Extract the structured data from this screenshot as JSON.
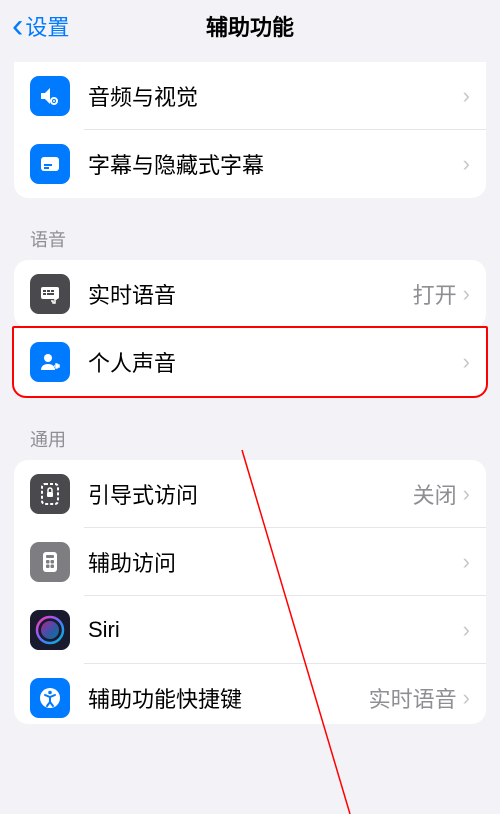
{
  "header": {
    "back_label": "设置",
    "title": "辅助功能"
  },
  "group1": {
    "items": [
      {
        "label": "音频与视觉",
        "icon": "audio-visual-icon"
      },
      {
        "label": "字幕与隐藏式字幕",
        "icon": "subtitles-icon"
      }
    ]
  },
  "group2": {
    "header": "语音",
    "items": [
      {
        "label": "实时语音",
        "value": "打开",
        "icon": "live-speech-icon"
      },
      {
        "label": "个人声音",
        "icon": "personal-voice-icon",
        "highlighted": true
      }
    ]
  },
  "group3": {
    "header": "通用",
    "items": [
      {
        "label": "引导式访问",
        "value": "关闭",
        "icon": "guided-access-icon"
      },
      {
        "label": "辅助访问",
        "icon": "assistive-access-icon"
      },
      {
        "label": "Siri",
        "icon": "siri-icon"
      },
      {
        "label": "辅助功能快捷键",
        "value": "实时语音",
        "icon": "shortcut-icon"
      }
    ]
  }
}
